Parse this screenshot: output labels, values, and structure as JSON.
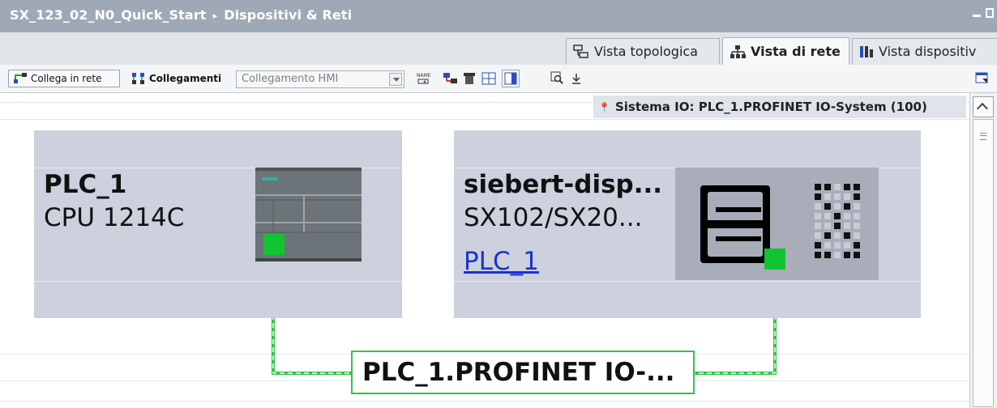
{
  "window": {
    "project": "SX_123_02_N0_Quick_Start",
    "breadcrumb_separator": "▸",
    "section": "Dispositivi & Reti"
  },
  "view_tabs": [
    {
      "label": "Vista topologica",
      "icon": "topology-view-icon",
      "active": false
    },
    {
      "label": "Vista di rete",
      "icon": "network-view-icon",
      "active": true
    },
    {
      "label": "Vista dispositiv",
      "icon": "device-view-icon",
      "active": false
    }
  ],
  "toolbar": {
    "connect_label": "Collega in rete",
    "connections_label": "Collegamenti",
    "connection_type": "Collegamento HMI",
    "icons": [
      "name-assignment-icon",
      "network-overview-icon",
      "io-system-icon",
      "grid-icon",
      "table-view-icon",
      "zoom-icon",
      "collapse-icon"
    ]
  },
  "io_system": {
    "pin_icon": "pin-icon",
    "label": "Sistema IO: PLC_1.PROFINET IO-System (100)"
  },
  "devices": [
    {
      "name": "PLC_1",
      "type": "CPU 1214C",
      "link": ""
    },
    {
      "name": "siebert-disp...",
      "type": "SX102/SX20...",
      "link": "PLC_1"
    }
  ],
  "subnet": {
    "label": "PLC_1.PROFINET  IO-...",
    "color": "#32c24a"
  },
  "colors": {
    "port": "#12c332",
    "device_bg": "#ccd1dd",
    "link": "#1a31d8",
    "titlebar": "#9fa9b6"
  }
}
